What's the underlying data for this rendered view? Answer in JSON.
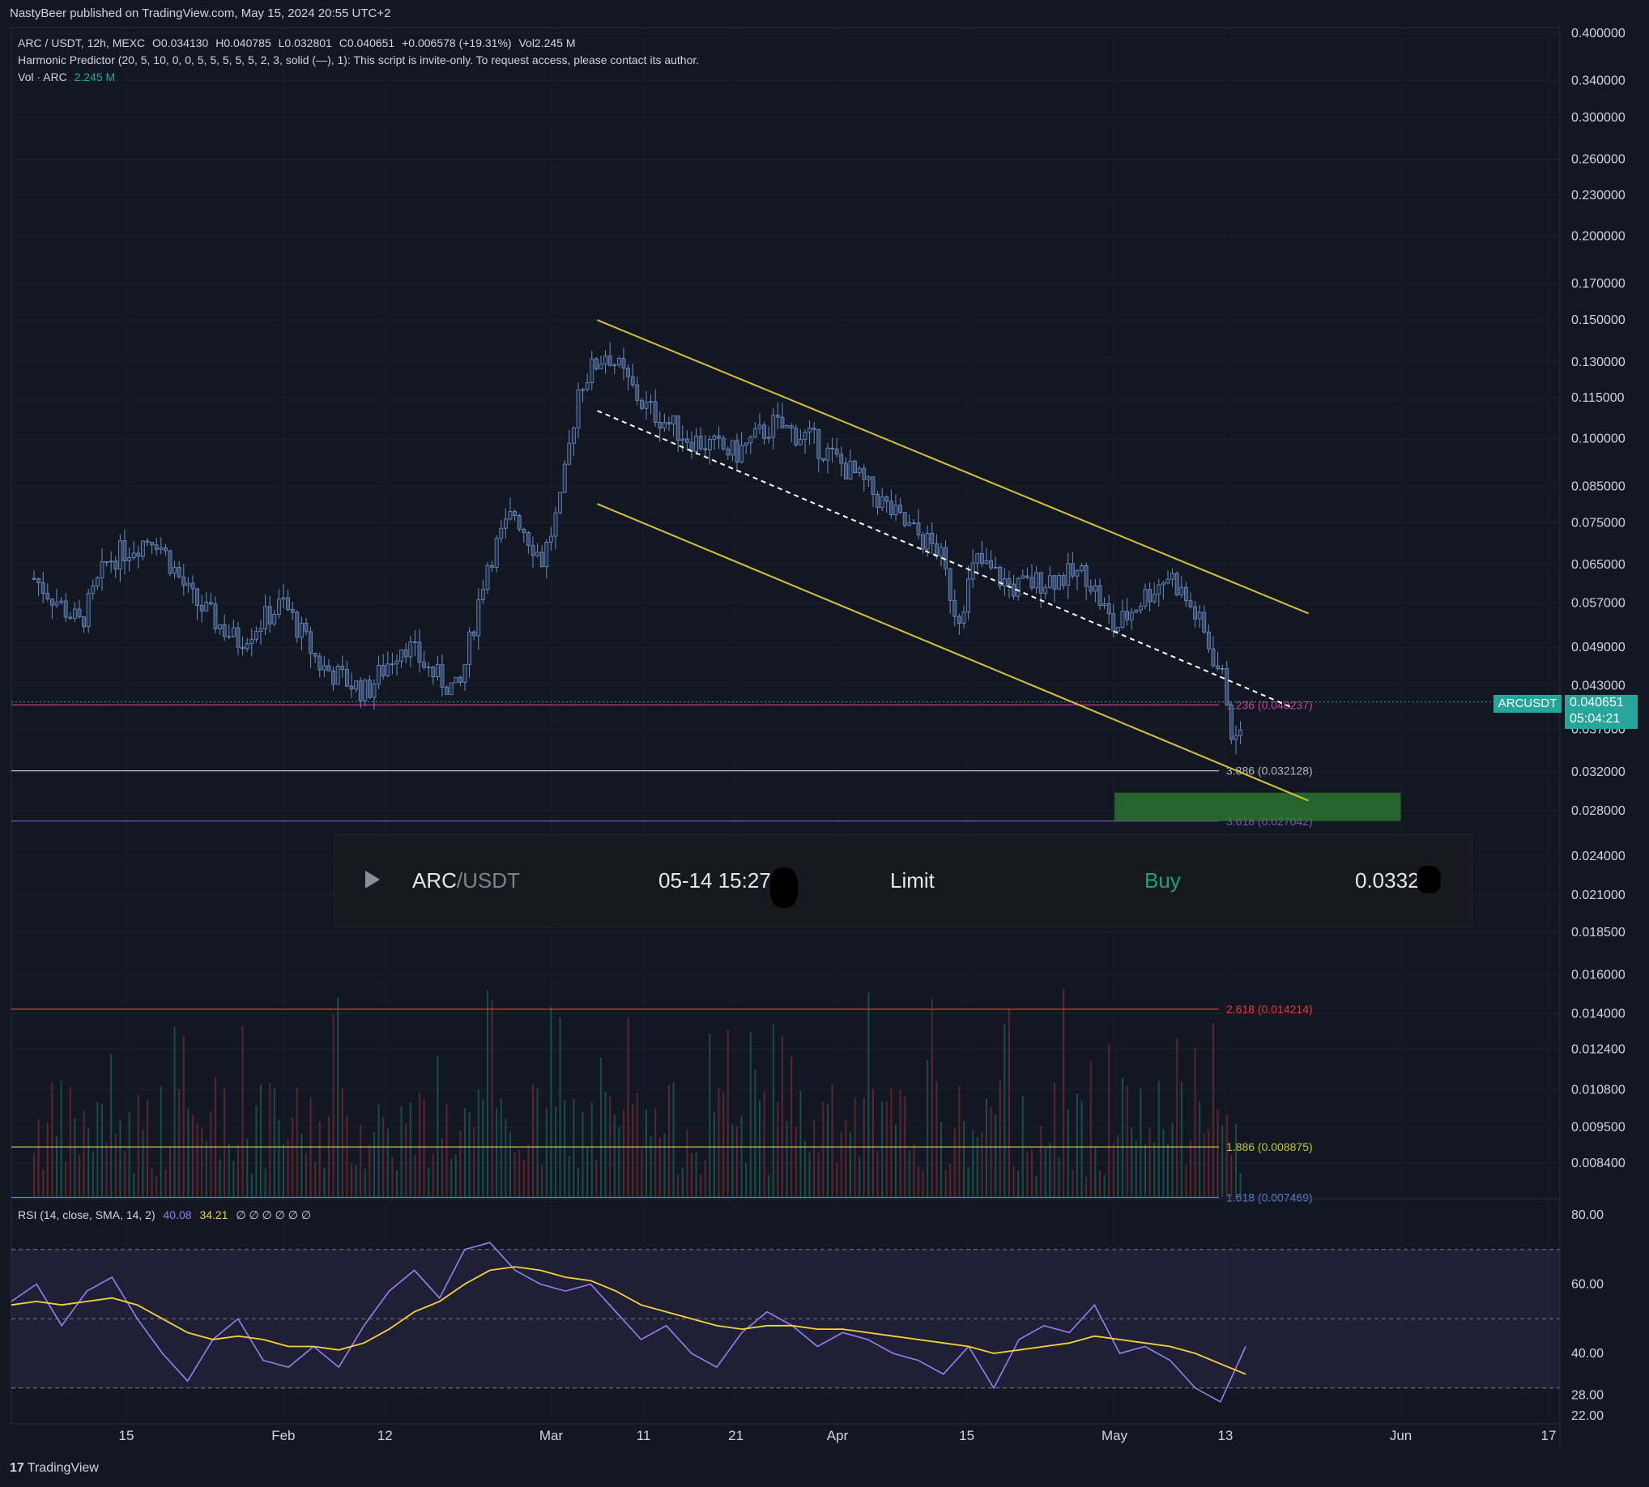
{
  "header": {
    "published_by": "NastyBeer published on TradingView.com, May 15, 2024 20:55 UTC+2"
  },
  "legend": {
    "symbol": "ARC / USDT, 12h, MEXC",
    "open": "O0.034130",
    "high": "H0.040785",
    "low": "L0.032801",
    "close": "C0.040651",
    "change": "+0.006578 (+19.31%)",
    "volume": "Vol2.245 M",
    "indicator": "Harmonic Predictor (20, 5, 10, 0, 0, 5, 5, 5, 5, 5, 2, 3, solid (—), 1): This script is invite-only. To request access, please contact its author.",
    "vol_label": "Vol · ARC",
    "vol_value": "2.245 M"
  },
  "rsi_legend": {
    "label": "RSI (14, close, SMA, 14, 2)",
    "rsi_value": "40.08",
    "sma_value": "34.21",
    "empties": "∅ ∅ ∅ ∅ ∅ ∅"
  },
  "current_price": {
    "symbol": "ARCUSDT",
    "price": "0.040651",
    "countdown": "05:04:21"
  },
  "order_banner": {
    "pair_base": "ARC",
    "pair_quote": "/USDT",
    "time": "05-14 15:27",
    "type": "Limit",
    "side": "Buy",
    "price": "0.0332"
  },
  "footer": {
    "brand": "TradingView",
    "mark": "17"
  },
  "colors": {
    "background": "#131722",
    "up": "#5b9bd5",
    "channel": "#d4c435",
    "target_zone": "#2e7d32",
    "rsi": "#9c7ef0",
    "rsi_sma": "#f5d33a",
    "price_badge": "#26a69a"
  },
  "chart_data": [
    {
      "type": "candlestick",
      "title": "ARC / USDT, 12h, MEXC",
      "y_scale": "log",
      "y_ticks": [
        "0.400000",
        "0.340000",
        "0.300000",
        "0.260000",
        "0.230000",
        "0.200000",
        "0.170000",
        "0.150000",
        "0.130000",
        "0.115000",
        "0.100000",
        "0.085000",
        "0.075000",
        "0.065000",
        "0.057000",
        "0.049000",
        "0.043000",
        "0.037000",
        "0.032000",
        "0.028000",
        "0.024000",
        "0.021000",
        "0.018500",
        "0.016000",
        "0.014000",
        "0.012400",
        "0.010800",
        "0.009500",
        "0.008400"
      ],
      "x_ticks": [
        "15",
        "Feb",
        "12",
        "Mar",
        "11",
        "21",
        "Apr",
        "15",
        "May",
        "13",
        "Jun",
        "17"
      ],
      "price_path": [
        [
          "Jan 5",
          0.062
        ],
        [
          "Jan 10",
          0.053
        ],
        [
          "Jan 13",
          0.066
        ],
        [
          "Jan 18",
          0.072
        ],
        [
          "Jan 22",
          0.058
        ],
        [
          "Jan 27",
          0.05
        ],
        [
          "Feb 1",
          0.057
        ],
        [
          "Feb 5",
          0.046
        ],
        [
          "Feb 10",
          0.042
        ],
        [
          "Feb 14",
          0.05
        ],
        [
          "Feb 17",
          0.045
        ],
        [
          "Feb 20",
          0.042
        ],
        [
          "Feb 23",
          0.065
        ],
        [
          "Feb 26",
          0.078
        ],
        [
          "Feb 29",
          0.066
        ],
        [
          "Mar 2",
          0.08
        ],
        [
          "Mar 4",
          0.12
        ],
        [
          "Mar 7",
          0.135
        ],
        [
          "Mar 11",
          0.112
        ],
        [
          "Mar 16",
          0.1
        ],
        [
          "Mar 21",
          0.095
        ],
        [
          "Mar 25",
          0.105
        ],
        [
          "Mar 29",
          0.1
        ],
        [
          "Apr 3",
          0.088
        ],
        [
          "Apr 8",
          0.075
        ],
        [
          "Apr 12",
          0.068
        ],
        [
          "Apr 14",
          0.054
        ],
        [
          "Apr 16",
          0.066
        ],
        [
          "Apr 20",
          0.06
        ],
        [
          "Apr 24",
          0.062
        ],
        [
          "Apr 28",
          0.063
        ],
        [
          "May 1",
          0.052
        ],
        [
          "May 4",
          0.058
        ],
        [
          "May 7",
          0.063
        ],
        [
          "May 10",
          0.054
        ],
        [
          "May 13",
          0.043
        ],
        [
          "May 14",
          0.034
        ],
        [
          "May 15",
          0.0407
        ]
      ],
      "channel_upper": [
        [
          "Mar 6",
          0.15
        ],
        [
          "May 22",
          0.055
        ]
      ],
      "channel_lower": [
        [
          "Mar 6",
          0.08
        ],
        [
          "May 22",
          0.029
        ]
      ],
      "channel_mid": [
        [
          "Mar 6",
          0.11
        ],
        [
          "May 20",
          0.04
        ]
      ],
      "levels": [
        {
          "label": "1.236 (0.040237)",
          "value": 0.040237,
          "color": "#c7449b"
        },
        {
          "label": "3.886 (0.032128)",
          "value": 0.032128,
          "color": "#b2b5be"
        },
        {
          "label": "3.618 (0.027042)",
          "value": 0.027042,
          "color": "#7e57c2"
        },
        {
          "label": "2.618 (0.014214)",
          "value": 0.014214,
          "color": "#e53935"
        },
        {
          "label": "1.886 (0.008875)",
          "value": 0.008875,
          "color": "#c0ca33"
        },
        {
          "label": "1.618 (0.007469)",
          "value": 0.007469,
          "color": "#5b7fd5"
        }
      ],
      "target_zone": {
        "from": "May 1",
        "to": "Jun 1",
        "low": 0.027042,
        "high": 0.0298
      }
    },
    {
      "type": "line",
      "title": "RSI (14, close, SMA, 14, 2)",
      "y_ticks": [
        "80.00",
        "60.00",
        "40.00",
        "28.00",
        "22.00"
      ],
      "overbought": 70,
      "oversold": 30,
      "series": [
        {
          "name": "RSI",
          "values": [
            55,
            60,
            48,
            58,
            62,
            50,
            40,
            32,
            44,
            50,
            38,
            36,
            42,
            36,
            48,
            58,
            64,
            56,
            70,
            72,
            64,
            60,
            58,
            60,
            52,
            44,
            48,
            40,
            36,
            46,
            52,
            48,
            42,
            46,
            44,
            40,
            38,
            34,
            42,
            30,
            44,
            48,
            46,
            54,
            40,
            42,
            38,
            30,
            26,
            42
          ]
        },
        {
          "name": "SMA",
          "values": [
            54,
            55,
            54,
            55,
            56,
            54,
            50,
            46,
            44,
            45,
            44,
            42,
            42,
            41,
            43,
            47,
            52,
            55,
            60,
            64,
            65,
            64,
            62,
            61,
            58,
            54,
            52,
            50,
            48,
            47,
            48,
            48,
            47,
            47,
            46,
            45,
            44,
            43,
            42,
            40,
            41,
            42,
            43,
            45,
            44,
            43,
            42,
            40,
            37,
            34
          ]
        }
      ]
    }
  ]
}
